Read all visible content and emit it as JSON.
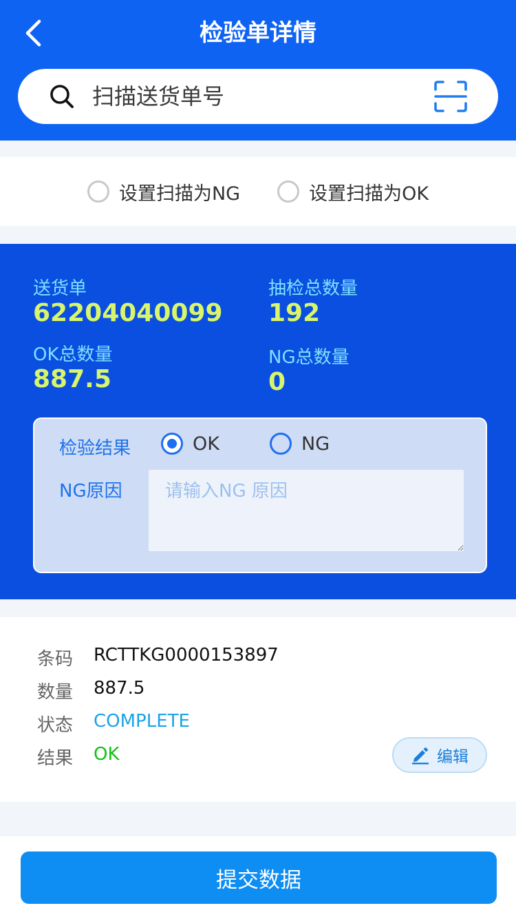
{
  "header": {
    "title": "检验单详情",
    "search_placeholder": "扫描送货单号"
  },
  "scan_mode": {
    "option_ng": "设置扫描为NG",
    "option_ok": "设置扫描为OK"
  },
  "summary": {
    "delivery_label": "送货单",
    "delivery_value": "62204040099",
    "sample_total_label": "抽检总数量",
    "sample_total_value": "192",
    "ok_total_label": "OK总数量",
    "ok_total_value": "887.5",
    "ng_total_label": "NG总数量",
    "ng_total_value": "0"
  },
  "inspection": {
    "result_label": "检验结果",
    "ok_option": "OK",
    "ng_option": "NG",
    "selected": "OK",
    "reason_label": "NG原因",
    "reason_placeholder": "请输入NG 原因",
    "reason_value": ""
  },
  "detail": {
    "barcode_key": "条码",
    "barcode_value": "RCTTKG0000153897",
    "quantity_key": "数量",
    "quantity_value": "887.5",
    "status_key": "状态",
    "status_value": "COMPLETE",
    "result_key": "结果",
    "result_value": "OK",
    "edit_label": "编辑"
  },
  "footer": {
    "submit_label": "提交数据"
  },
  "colors": {
    "header_blue": "#0f63f3",
    "summary_blue": "#0a4fe0",
    "label_cyan": "#7fe0ff",
    "value_yellow": "#d8f56b",
    "status_blue": "#1aa3e8",
    "result_green": "#12c212",
    "submit_blue": "#0e8df3"
  }
}
